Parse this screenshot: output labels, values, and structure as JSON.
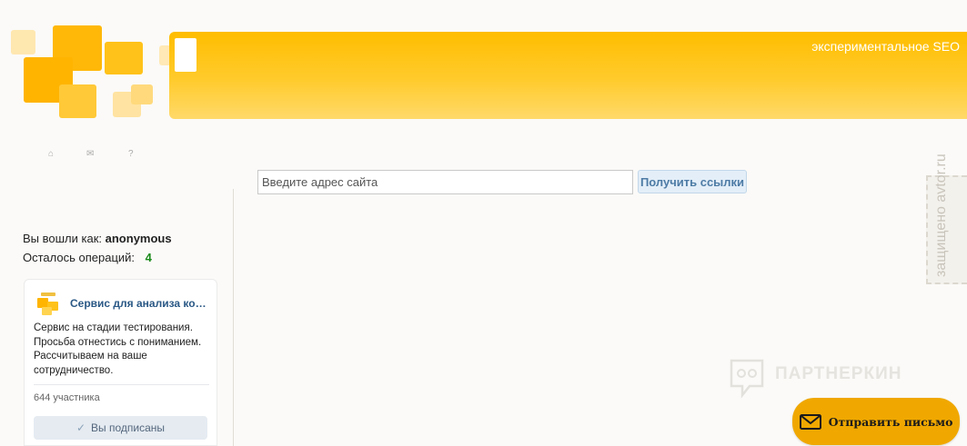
{
  "header": {
    "site_title": "экспериментальное SEO"
  },
  "nav_icons": [
    "home-icon",
    "mail-icon",
    "help-icon"
  ],
  "nav_glyphs": {
    "home": "⌂",
    "mail": "✉",
    "help": "?"
  },
  "search": {
    "placeholder": "Введите адрес сайта",
    "value": "",
    "button_label": "Получить ссылки"
  },
  "user": {
    "logged_in_prefix": "Вы вошли как:",
    "username": "anonymous",
    "ops_label": "Осталось операций:",
    "ops_count": "4"
  },
  "widget": {
    "title": "Сервис для анализа конт...",
    "description": "Сервис на стадии тестирования. Просьба отнестись с пониманием. Рассчитываем на ваше сотрудничество.",
    "members": "644 участника",
    "subscribe_label": "Вы подписаны",
    "check_glyph": "✓"
  },
  "watermarks": {
    "stamp": "защищено avtor.ru",
    "partner": "ПАРТНЕРКИН"
  },
  "mail_button": {
    "label": "Отправить письмо"
  },
  "colors": {
    "brand_yellow": "#ffbd00",
    "link_blue": "#2a5885",
    "count_green": "#1a8a1a",
    "mail_button": "#f0a800"
  }
}
